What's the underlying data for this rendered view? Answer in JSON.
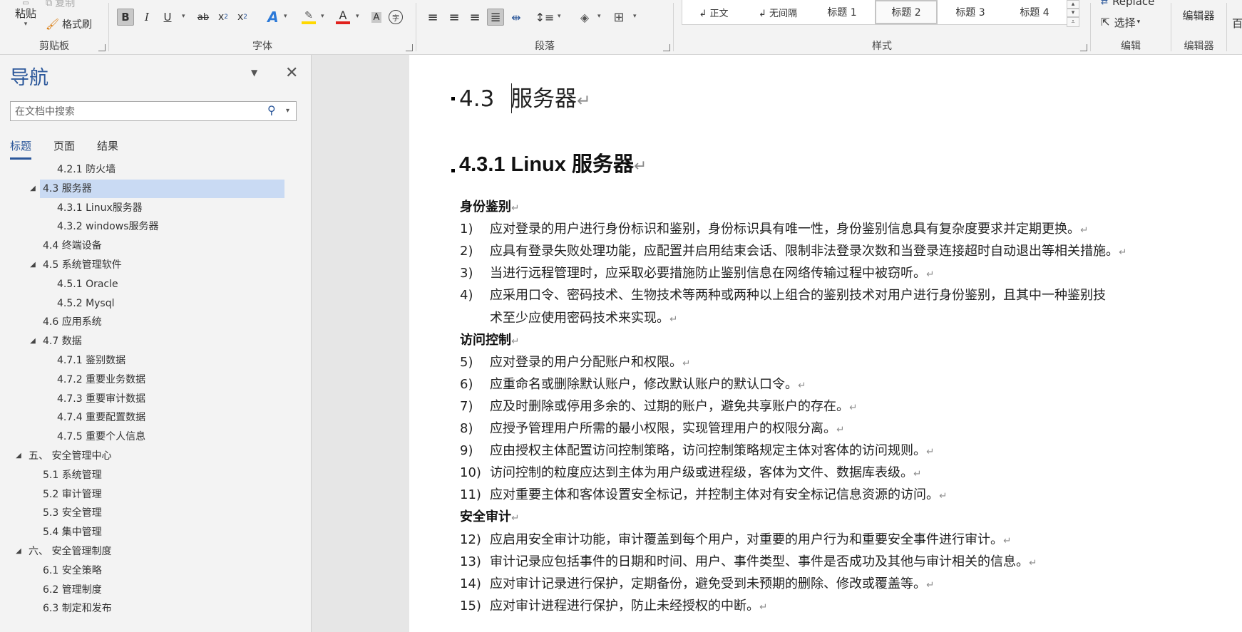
{
  "ribbon": {
    "clipboard": {
      "paste_label": "粘贴",
      "copy_label": "复制",
      "format_painter_label": "格式刷",
      "group_label": "剪贴板"
    },
    "font": {
      "group_label": "字体"
    },
    "paragraph": {
      "group_label": "段落"
    },
    "styles": {
      "group_label": "样式",
      "items": [
        "↲ 正文",
        "↲ 无间隔",
        "标题 1",
        "标题 2",
        "标题 3",
        "标题 4"
      ],
      "selected": "标题 2"
    },
    "editing": {
      "replace_label": "Replace",
      "select_label": "选择",
      "group_label": "编辑"
    },
    "editor": {
      "button_label": "编辑器",
      "group_label": "编辑器"
    },
    "cut_off_label": "百"
  },
  "nav": {
    "title": "导航",
    "search_placeholder": "在文档中搜索",
    "tabs": [
      "标题",
      "页面",
      "结果"
    ],
    "active_tab": "标题",
    "tree": [
      {
        "label": "4.2.1 防火墙",
        "level": 3,
        "expandable": false,
        "selected": false
      },
      {
        "label": "4.3 服务器",
        "level": 2,
        "expandable": true,
        "selected": true
      },
      {
        "label": "4.3.1 Linux服务器",
        "level": 3,
        "expandable": false,
        "selected": false
      },
      {
        "label": "4.3.2 windows服务器",
        "level": 3,
        "expandable": false,
        "selected": false
      },
      {
        "label": "4.4 终端设备",
        "level": 2,
        "expandable": false,
        "selected": false
      },
      {
        "label": "4.5 系统管理软件",
        "level": 2,
        "expandable": true,
        "selected": false
      },
      {
        "label": "4.5.1 Oracle",
        "level": 3,
        "expandable": false,
        "selected": false
      },
      {
        "label": "4.5.2 Mysql",
        "level": 3,
        "expandable": false,
        "selected": false
      },
      {
        "label": "4.6 应用系统",
        "level": 2,
        "expandable": false,
        "selected": false
      },
      {
        "label": "4.7 数据",
        "level": 2,
        "expandable": true,
        "selected": false
      },
      {
        "label": "4.7.1 鉴别数据",
        "level": 3,
        "expandable": false,
        "selected": false
      },
      {
        "label": "4.7.2 重要业务数据",
        "level": 3,
        "expandable": false,
        "selected": false
      },
      {
        "label": "4.7.3 重要审计数据",
        "level": 3,
        "expandable": false,
        "selected": false
      },
      {
        "label": "4.7.4 重要配置数据",
        "level": 3,
        "expandable": false,
        "selected": false
      },
      {
        "label": "4.7.5 重要个人信息",
        "level": 3,
        "expandable": false,
        "selected": false
      },
      {
        "label": "五、 安全管理中心",
        "level": 1,
        "expandable": true,
        "selected": false
      },
      {
        "label": "5.1 系统管理",
        "level": 2,
        "expandable": false,
        "selected": false
      },
      {
        "label": "5.2 审计管理",
        "level": 2,
        "expandable": false,
        "selected": false
      },
      {
        "label": "5.3 安全管理",
        "level": 2,
        "expandable": false,
        "selected": false
      },
      {
        "label": "5.4 集中管理",
        "level": 2,
        "expandable": false,
        "selected": false
      },
      {
        "label": "六、 安全管理制度",
        "level": 1,
        "expandable": true,
        "selected": false
      },
      {
        "label": "6.1 安全策略",
        "level": 2,
        "expandable": false,
        "selected": false
      },
      {
        "label": "6.2 管理制度",
        "level": 2,
        "expandable": false,
        "selected": false
      },
      {
        "label": "6.3 制定和发布",
        "level": 2,
        "expandable": false,
        "selected": false
      }
    ]
  },
  "document": {
    "h3_number": "4.3",
    "h3_text": "服务器",
    "h4_text": "4.3.1 Linux 服务器",
    "paragraph_mark": "↵",
    "sections": [
      {
        "heading": "身份鉴别",
        "items": [
          {
            "num": "1)",
            "text": "应对登录的用户进行身份标识和鉴别，身份标识具有唯一性，身份鉴别信息具有复杂度要求并定期更换。"
          },
          {
            "num": "2)",
            "text": "应具有登录失败处理功能，应配置并启用结束会话、限制非法登录次数和当登录连接超时自动退出等相关措施。"
          },
          {
            "num": "3)",
            "text": "当进行远程管理时，应采取必要措施防止鉴别信息在网络传输过程中被窃听。"
          },
          {
            "num": "4)",
            "text": "应采用口令、密码技术、生物技术等两种或两种以上组合的鉴别技术对用户进行身份鉴别，且其中一种鉴别技",
            "text2": "术至少应使用密码技术来实现。"
          }
        ]
      },
      {
        "heading": "访问控制",
        "items": [
          {
            "num": "5)",
            "text": "应对登录的用户分配账户和权限。"
          },
          {
            "num": "6)",
            "text": "应重命名或删除默认账户，修改默认账户的默认口令。"
          },
          {
            "num": "7)",
            "text": "应及时删除或停用多余的、过期的账户，避免共享账户的存在。"
          },
          {
            "num": "8)",
            "text": "应授予管理用户所需的最小权限，实现管理用户的权限分离。"
          },
          {
            "num": "9)",
            "text": "应由授权主体配置访问控制策略，访问控制策略规定主体对客体的访问规则。"
          },
          {
            "num": "10)",
            "text": "访问控制的粒度应达到主体为用户级或进程级，客体为文件、数据库表级。"
          },
          {
            "num": "11)",
            "text": "应对重要主体和客体设置安全标记，并控制主体对有安全标记信息资源的访问。"
          }
        ]
      },
      {
        "heading": "安全审计",
        "items": [
          {
            "num": "12)",
            "text": "应启用安全审计功能，审计覆盖到每个用户，对重要的用户行为和重要安全事件进行审计。"
          },
          {
            "num": "13)",
            "text": "审计记录应包括事件的日期和时间、用户、事件类型、事件是否成功及其他与审计相关的信息。"
          },
          {
            "num": "14)",
            "text": "应对审计记录进行保护，定期备份，避免受到未预期的删除、修改或覆盖等。"
          },
          {
            "num": "15)",
            "text": "应对审计进程进行保护，防止未经授权的中断。"
          }
        ]
      }
    ]
  },
  "colors": {
    "accent": "#2b579a",
    "selection": "#c9daf3",
    "highlight": "#ffd800",
    "font_color": "#e0201c"
  },
  "icons": {
    "paste": "clipboard-icon",
    "copy": "copy-icon",
    "format_painter": "paintbrush-icon",
    "search": "magnifier-icon",
    "close": "close-icon"
  }
}
